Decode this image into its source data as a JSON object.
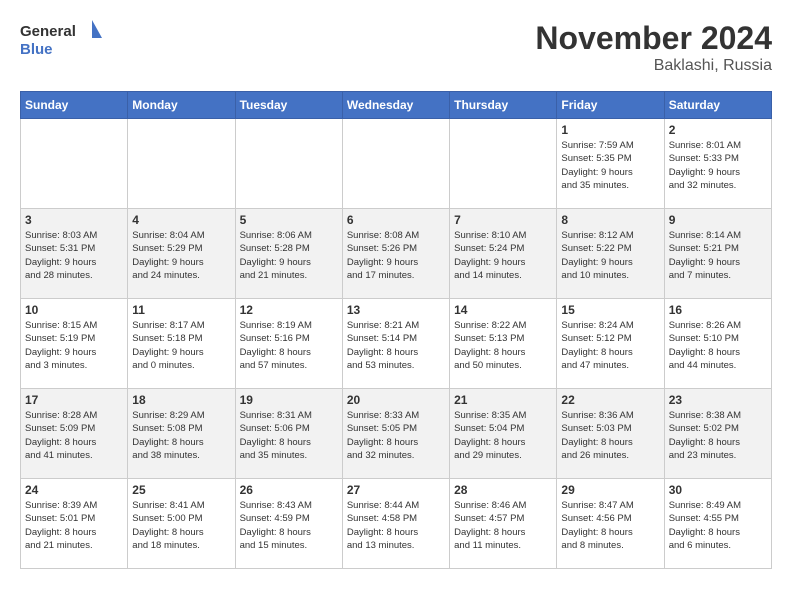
{
  "header": {
    "logo_line1": "General",
    "logo_line2": "Blue",
    "month": "November 2024",
    "location": "Baklashi, Russia"
  },
  "weekdays": [
    "Sunday",
    "Monday",
    "Tuesday",
    "Wednesday",
    "Thursday",
    "Friday",
    "Saturday"
  ],
  "weeks": [
    [
      {
        "day": "",
        "info": ""
      },
      {
        "day": "",
        "info": ""
      },
      {
        "day": "",
        "info": ""
      },
      {
        "day": "",
        "info": ""
      },
      {
        "day": "",
        "info": ""
      },
      {
        "day": "1",
        "info": "Sunrise: 7:59 AM\nSunset: 5:35 PM\nDaylight: 9 hours\nand 35 minutes."
      },
      {
        "day": "2",
        "info": "Sunrise: 8:01 AM\nSunset: 5:33 PM\nDaylight: 9 hours\nand 32 minutes."
      }
    ],
    [
      {
        "day": "3",
        "info": "Sunrise: 8:03 AM\nSunset: 5:31 PM\nDaylight: 9 hours\nand 28 minutes."
      },
      {
        "day": "4",
        "info": "Sunrise: 8:04 AM\nSunset: 5:29 PM\nDaylight: 9 hours\nand 24 minutes."
      },
      {
        "day": "5",
        "info": "Sunrise: 8:06 AM\nSunset: 5:28 PM\nDaylight: 9 hours\nand 21 minutes."
      },
      {
        "day": "6",
        "info": "Sunrise: 8:08 AM\nSunset: 5:26 PM\nDaylight: 9 hours\nand 17 minutes."
      },
      {
        "day": "7",
        "info": "Sunrise: 8:10 AM\nSunset: 5:24 PM\nDaylight: 9 hours\nand 14 minutes."
      },
      {
        "day": "8",
        "info": "Sunrise: 8:12 AM\nSunset: 5:22 PM\nDaylight: 9 hours\nand 10 minutes."
      },
      {
        "day": "9",
        "info": "Sunrise: 8:14 AM\nSunset: 5:21 PM\nDaylight: 9 hours\nand 7 minutes."
      }
    ],
    [
      {
        "day": "10",
        "info": "Sunrise: 8:15 AM\nSunset: 5:19 PM\nDaylight: 9 hours\nand 3 minutes."
      },
      {
        "day": "11",
        "info": "Sunrise: 8:17 AM\nSunset: 5:18 PM\nDaylight: 9 hours\nand 0 minutes."
      },
      {
        "day": "12",
        "info": "Sunrise: 8:19 AM\nSunset: 5:16 PM\nDaylight: 8 hours\nand 57 minutes."
      },
      {
        "day": "13",
        "info": "Sunrise: 8:21 AM\nSunset: 5:14 PM\nDaylight: 8 hours\nand 53 minutes."
      },
      {
        "day": "14",
        "info": "Sunrise: 8:22 AM\nSunset: 5:13 PM\nDaylight: 8 hours\nand 50 minutes."
      },
      {
        "day": "15",
        "info": "Sunrise: 8:24 AM\nSunset: 5:12 PM\nDaylight: 8 hours\nand 47 minutes."
      },
      {
        "day": "16",
        "info": "Sunrise: 8:26 AM\nSunset: 5:10 PM\nDaylight: 8 hours\nand 44 minutes."
      }
    ],
    [
      {
        "day": "17",
        "info": "Sunrise: 8:28 AM\nSunset: 5:09 PM\nDaylight: 8 hours\nand 41 minutes."
      },
      {
        "day": "18",
        "info": "Sunrise: 8:29 AM\nSunset: 5:08 PM\nDaylight: 8 hours\nand 38 minutes."
      },
      {
        "day": "19",
        "info": "Sunrise: 8:31 AM\nSunset: 5:06 PM\nDaylight: 8 hours\nand 35 minutes."
      },
      {
        "day": "20",
        "info": "Sunrise: 8:33 AM\nSunset: 5:05 PM\nDaylight: 8 hours\nand 32 minutes."
      },
      {
        "day": "21",
        "info": "Sunrise: 8:35 AM\nSunset: 5:04 PM\nDaylight: 8 hours\nand 29 minutes."
      },
      {
        "day": "22",
        "info": "Sunrise: 8:36 AM\nSunset: 5:03 PM\nDaylight: 8 hours\nand 26 minutes."
      },
      {
        "day": "23",
        "info": "Sunrise: 8:38 AM\nSunset: 5:02 PM\nDaylight: 8 hours\nand 23 minutes."
      }
    ],
    [
      {
        "day": "24",
        "info": "Sunrise: 8:39 AM\nSunset: 5:01 PM\nDaylight: 8 hours\nand 21 minutes."
      },
      {
        "day": "25",
        "info": "Sunrise: 8:41 AM\nSunset: 5:00 PM\nDaylight: 8 hours\nand 18 minutes."
      },
      {
        "day": "26",
        "info": "Sunrise: 8:43 AM\nSunset: 4:59 PM\nDaylight: 8 hours\nand 15 minutes."
      },
      {
        "day": "27",
        "info": "Sunrise: 8:44 AM\nSunset: 4:58 PM\nDaylight: 8 hours\nand 13 minutes."
      },
      {
        "day": "28",
        "info": "Sunrise: 8:46 AM\nSunset: 4:57 PM\nDaylight: 8 hours\nand 11 minutes."
      },
      {
        "day": "29",
        "info": "Sunrise: 8:47 AM\nSunset: 4:56 PM\nDaylight: 8 hours\nand 8 minutes."
      },
      {
        "day": "30",
        "info": "Sunrise: 8:49 AM\nSunset: 4:55 PM\nDaylight: 8 hours\nand 6 minutes."
      }
    ]
  ]
}
